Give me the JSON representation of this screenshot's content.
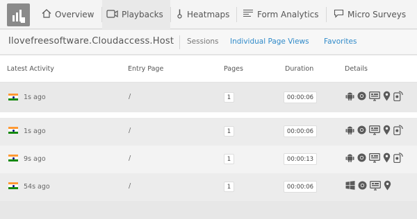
{
  "nav": {
    "tabs": [
      {
        "label": "Overview",
        "icon": "home-icon"
      },
      {
        "label": "Playbacks",
        "icon": "video-icon"
      },
      {
        "label": "Heatmaps",
        "icon": "thermometer-icon"
      },
      {
        "label": "Form Analytics",
        "icon": "form-icon"
      },
      {
        "label": "Micro Surveys",
        "icon": "chat-icon"
      }
    ]
  },
  "subnav": {
    "site": "Ilovefreesoftware.Cloudaccess.Host",
    "sessions": "Sessions",
    "page_views": "Individual Page Views",
    "favorites": "Favorites"
  },
  "table": {
    "headers": [
      "Latest Activity",
      "Entry Page",
      "Pages",
      "Duration",
      "Details"
    ],
    "rows": [
      {
        "ago": "1s ago",
        "entry": "/",
        "pages": "1",
        "duration": "00:00:06",
        "os": "android-icon"
      },
      {
        "ago": "1s ago",
        "entry": "/",
        "pages": "1",
        "duration": "00:00:06",
        "os": "android-icon"
      },
      {
        "ago": "9s ago",
        "entry": "/",
        "pages": "1",
        "duration": "00:00:13",
        "os": "android-icon"
      },
      {
        "ago": "54s ago",
        "entry": "/",
        "pages": "1",
        "duration": "00:00:06",
        "os": "windows-icon"
      }
    ]
  },
  "colors": {
    "link_blue": "#2f8ac9",
    "icon_gray": "#5a5a5a",
    "flag_saffron": "#ff9933",
    "flag_green": "#138808"
  }
}
